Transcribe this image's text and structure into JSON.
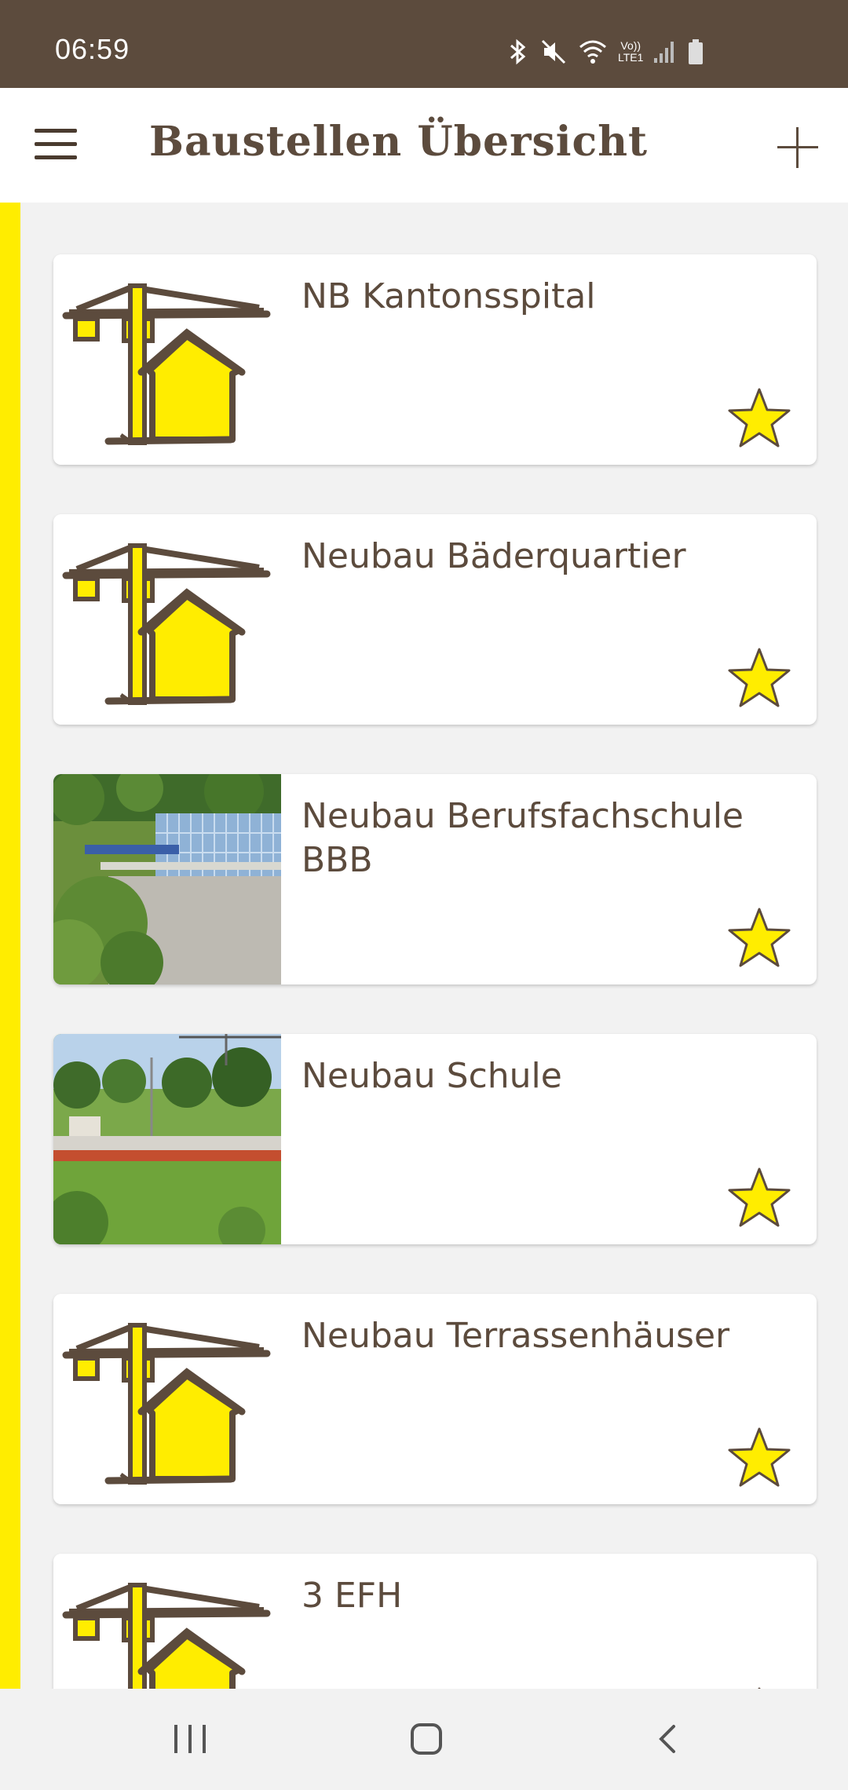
{
  "status_bar": {
    "time": "06:59",
    "network_label_top": "Vo))",
    "network_label_bottom": "LTE1",
    "icons": [
      "bluetooth-icon",
      "mute-icon",
      "wifi-icon",
      "signal-icon",
      "battery-icon"
    ]
  },
  "app_bar": {
    "title": "Baustellen Übersicht",
    "menu_icon": "hamburger-menu-icon",
    "add_icon": "plus-icon"
  },
  "colors": {
    "brand_brown": "#5c4b3d",
    "accent_yellow": "#ffed00",
    "background": "#f2f2f2"
  },
  "projects": [
    {
      "title": "NB Kantonsspital",
      "thumbnail": "crane-house-logo",
      "favorite": true
    },
    {
      "title": "Neubau Bäderquartier",
      "thumbnail": "crane-house-logo",
      "favorite": true
    },
    {
      "title": "Neubau Berufsfachschule BBB",
      "thumbnail": "building-photo",
      "favorite": true
    },
    {
      "title": "Neubau Schule",
      "thumbnail": "construction-site-photo",
      "favorite": true
    },
    {
      "title": "Neubau Terrassenhäuser",
      "thumbnail": "crane-house-logo",
      "favorite": true
    },
    {
      "title": "3 EFH",
      "thumbnail": "crane-house-logo",
      "favorite": true
    }
  ],
  "nav_bar": {
    "icons": [
      "recent-apps-icon",
      "home-icon",
      "back-icon"
    ]
  }
}
